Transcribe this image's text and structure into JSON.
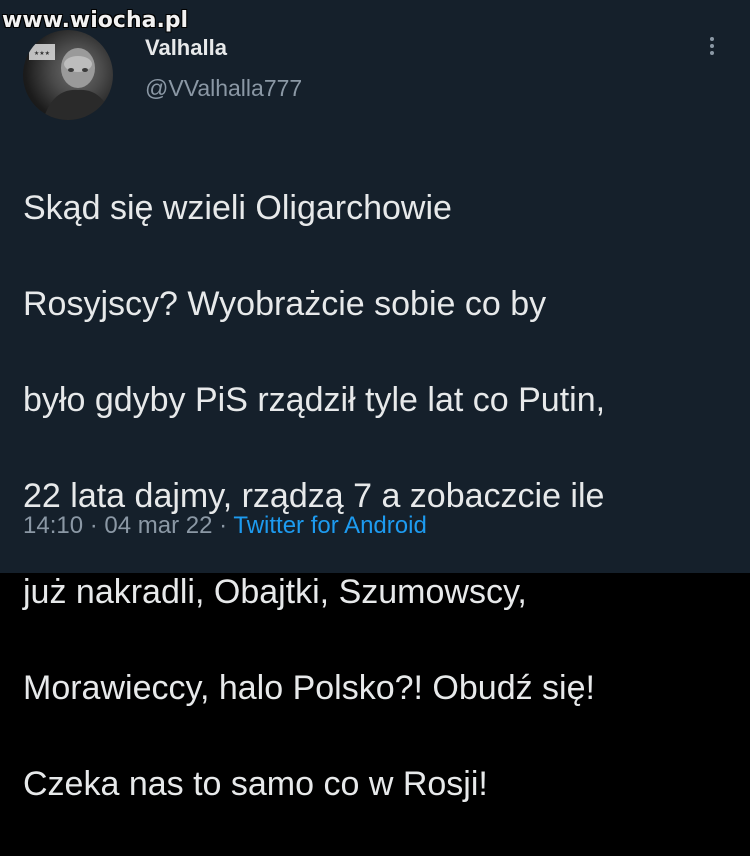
{
  "watermark": "www.wiocha.pl",
  "tweet": {
    "display_name": "Valhalla",
    "handle": "@VValhalla777",
    "text_lines": [
      "Skąd się wzieli Oligarchowie",
      "Rosyjscy? Wyobrażcie sobie co by",
      "było gdyby PiS rządził tyle lat co Putin,",
      "22 lata dajmy, rządzą 7 a zobaczcie ile",
      "już nakradli, Obajtki, Szumowscy,",
      "Morawieccy, halo Polsko?! Obudź się!",
      "Czeka nas to samo co w Rosji!"
    ],
    "time": "14:10",
    "separator": "·",
    "date": "04 mar 22",
    "source": "Twitter for Android"
  },
  "icons": {
    "more": "more-vertical-icon"
  },
  "colors": {
    "background": "#15202b",
    "text": "#e7e9ea",
    "secondary": "#8b98a5",
    "link": "#1d9bf0"
  }
}
